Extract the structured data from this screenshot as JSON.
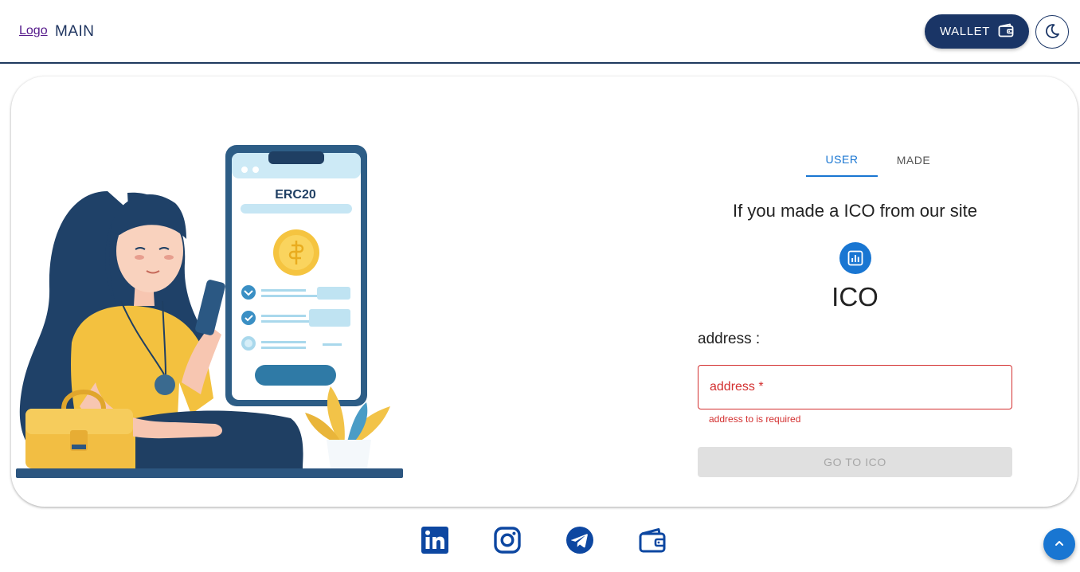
{
  "header": {
    "logo_text": "Logo",
    "title": "MAIN",
    "wallet_label": "WALLET",
    "wallet_icon": "wallet-icon",
    "theme_icon": "moon-icon"
  },
  "illustration": {
    "phone_label": "ERC20"
  },
  "tabs": [
    {
      "label": "USER",
      "active": true
    },
    {
      "label": "MADE",
      "active": false
    }
  ],
  "form": {
    "info_text": "If you made a ICO from our site",
    "icon": "bar-chart-icon",
    "title": "ICO",
    "address_label": "address :",
    "address_placeholder": "address *",
    "address_value": "",
    "helper_text": "address to is required",
    "submit_label": "GO TO ICO"
  },
  "footer": {
    "social_icons": [
      "linkedin-icon",
      "instagram-icon",
      "telegram-icon",
      "wallet-icon"
    ],
    "scroll_top_icon": "chevron-up-icon"
  },
  "colors": {
    "primary": "#1976d2",
    "navy": "#1a3566",
    "error": "#d32f2f",
    "disabled_bg": "#e0e0e0",
    "icon_blue": "#0d47a1"
  }
}
